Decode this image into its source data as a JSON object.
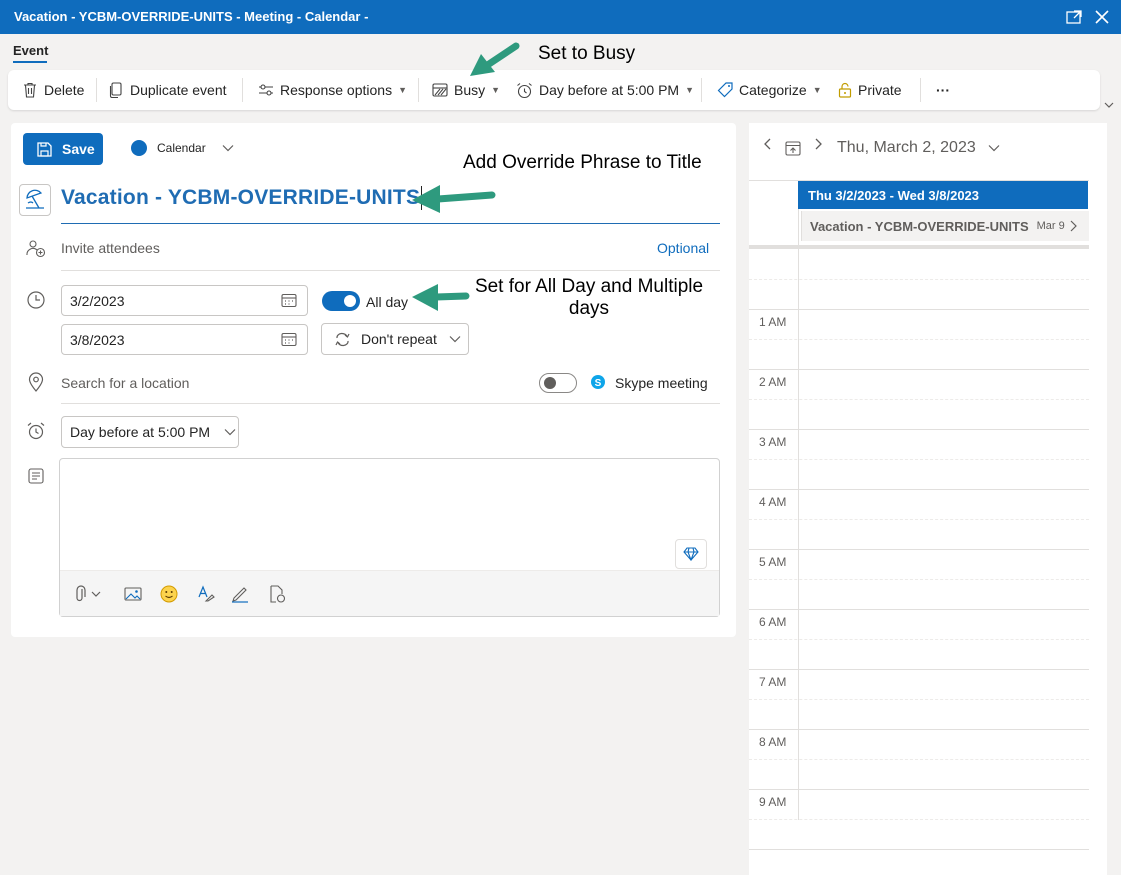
{
  "window": {
    "title": "Vacation - YCBM-OVERRIDE-UNITS - Meeting - Calendar -"
  },
  "tabs": {
    "event": "Event"
  },
  "ribbon": {
    "delete": "Delete",
    "duplicate": "Duplicate event",
    "response_options": "Response options",
    "busy": "Busy",
    "reminder": "Day before at 5:00 PM",
    "categorize": "Categorize",
    "private": "Private",
    "more": "···"
  },
  "form": {
    "save": "Save",
    "calendar": "Calendar",
    "title_value": "Vacation - YCBM-OVERRIDE-UNITS",
    "attendees_placeholder": "Invite attendees",
    "optional": "Optional",
    "start_date": "3/2/2023",
    "end_date": "3/8/2023",
    "all_day_label": "All day",
    "all_day_on": true,
    "repeat": "Don't repeat",
    "location_placeholder": "Search for a location",
    "skype_label": "Skype meeting",
    "skype_on": false,
    "reminder": "Day before at 5:00 PM"
  },
  "annotations": {
    "busy": "Set to Busy",
    "title": "Add Override Phrase to Title",
    "allday_line1": "Set for All Day and Multiple",
    "allday_line2": "days",
    "arrow_color": "#2e9a7e"
  },
  "calendar_panel": {
    "date": "Thu, March 2, 2023",
    "allday_event": "Thu 3/2/2023 - Wed 3/8/2023",
    "event_title": "Vacation - YCBM-OVERRIDE-UNITS",
    "event_end": "Mar 9",
    "hours": [
      "1 AM",
      "2 AM",
      "3 AM",
      "4 AM",
      "5 AM",
      "6 AM",
      "7 AM",
      "8 AM",
      "9 AM"
    ]
  },
  "colors": {
    "accent": "#0f6cbd",
    "title_text": "#1f6cb3",
    "background": "#f3f2f1"
  }
}
